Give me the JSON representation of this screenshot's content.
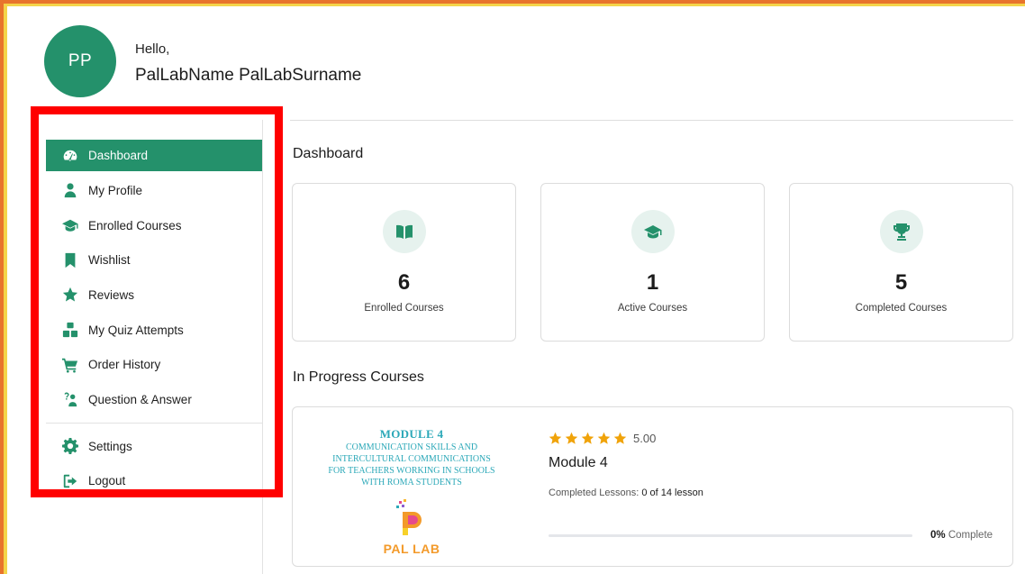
{
  "user": {
    "initials": "PP",
    "greeting": "Hello,",
    "name": "PalLabName PalLabSurname"
  },
  "sidebar": {
    "items": [
      {
        "label": "Dashboard",
        "icon": "dashboard-icon",
        "active": true
      },
      {
        "label": "My Profile",
        "icon": "user-icon"
      },
      {
        "label": "Enrolled Courses",
        "icon": "graduation-cap-icon"
      },
      {
        "label": "Wishlist",
        "icon": "bookmark-icon"
      },
      {
        "label": "Reviews",
        "icon": "star-icon"
      },
      {
        "label": "My Quiz Attempts",
        "icon": "quiz-blocks-icon"
      },
      {
        "label": "Order History",
        "icon": "cart-icon"
      },
      {
        "label": "Question & Answer",
        "icon": "question-person-icon"
      }
    ],
    "bottom_items": [
      {
        "label": "Settings",
        "icon": "gear-icon"
      },
      {
        "label": "Logout",
        "icon": "logout-icon"
      }
    ]
  },
  "main": {
    "dashboard_title": "Dashboard",
    "stats": [
      {
        "value": "6",
        "label": "Enrolled Courses",
        "icon": "book-icon"
      },
      {
        "value": "1",
        "label": "Active Courses",
        "icon": "graduation-cap-icon"
      },
      {
        "value": "5",
        "label": "Completed Courses",
        "icon": "trophy-icon"
      }
    ],
    "in_progress_title": "In Progress Courses",
    "course": {
      "thumb_title": "MODULE 4",
      "thumb_subtitle_lines": [
        "COMMUNICATION SKILLS AND",
        "INTERCULTURAL COMMUNICATIONS",
        "FOR TEACHERS WORKING IN SCHOOLS",
        "WITH ROMA STUDENTS"
      ],
      "thumb_brand": "PAL LAB",
      "rating": "5.00",
      "stars": 5,
      "title": "Module 4",
      "lessons_label": "Completed Lessons:",
      "lessons_value": "0 of 14 lesson",
      "progress_percent": 0,
      "progress_value": "0%",
      "progress_label": "Complete"
    }
  },
  "colors": {
    "accent": "#24916b",
    "highlight": "#ff0000",
    "star": "#f0a30a"
  }
}
